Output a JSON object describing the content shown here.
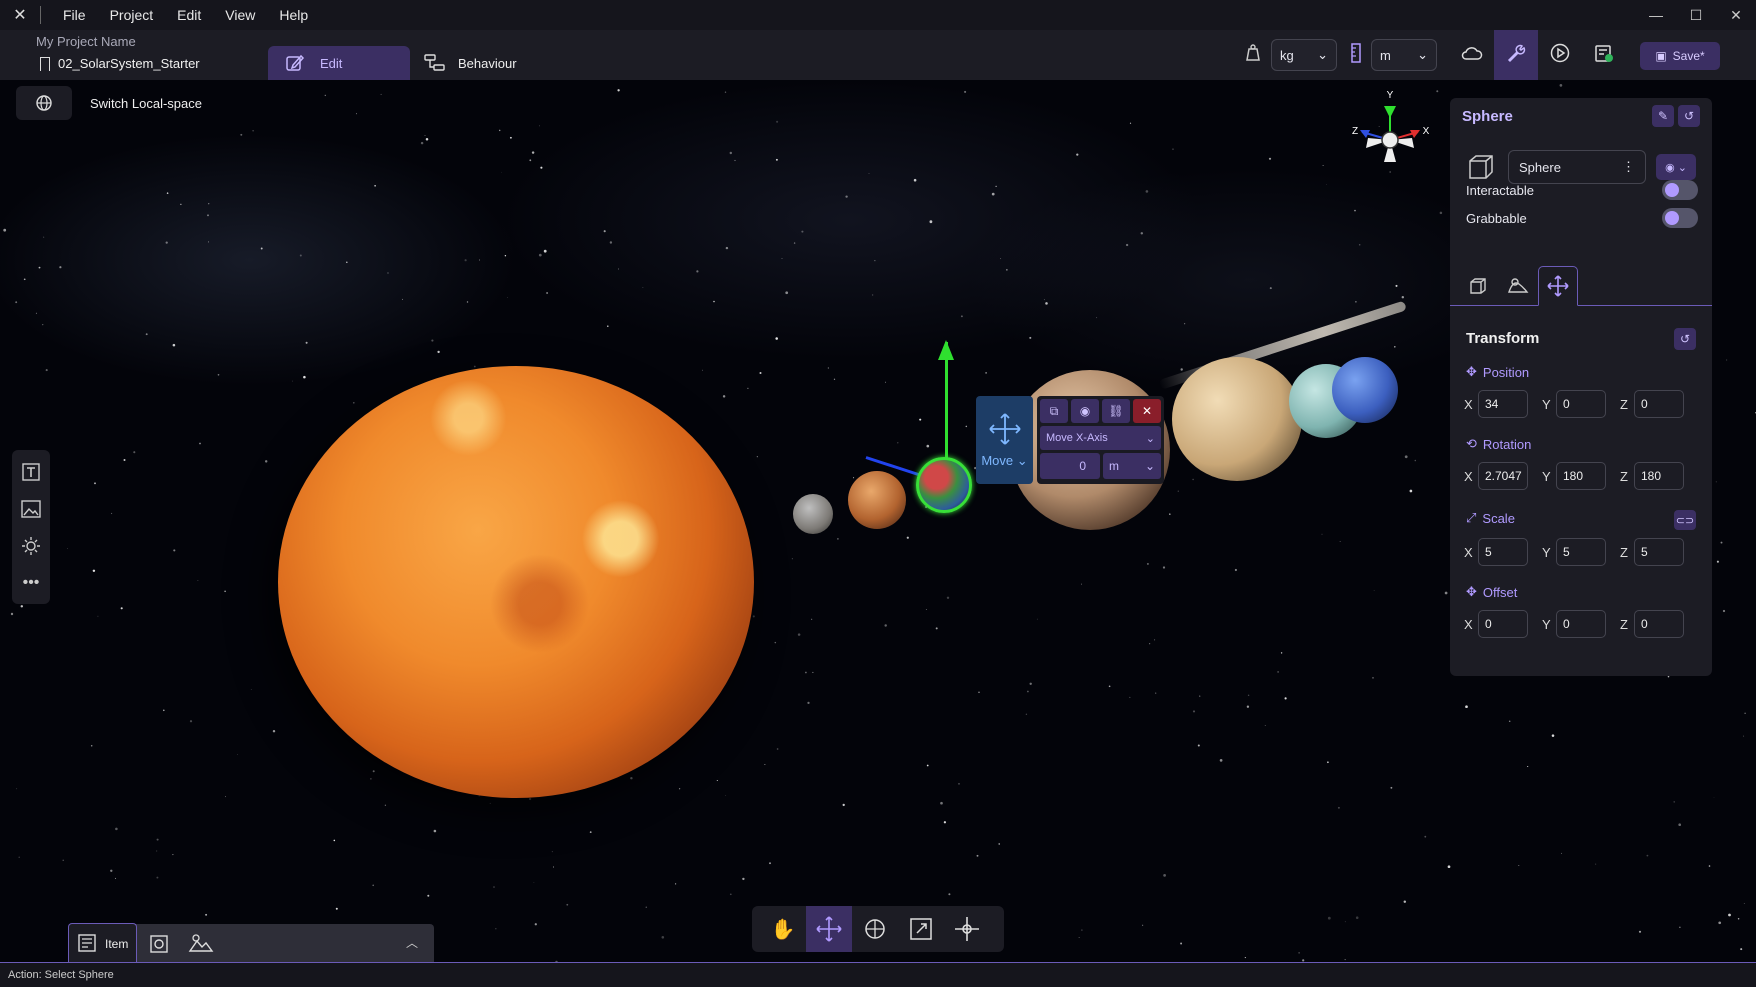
{
  "menubar": {
    "items": [
      "File",
      "Project",
      "Edit",
      "View",
      "Help"
    ]
  },
  "toolbar": {
    "project_name": "My Project Name",
    "scene_name": "02_SolarSystem_Starter",
    "tabs": [
      {
        "label": "Edit",
        "active": true
      },
      {
        "label": "Behaviour",
        "active": false
      }
    ],
    "mass_unit": "kg",
    "length_unit": "m",
    "save_label": "Save*"
  },
  "viewport": {
    "switch_local_label": "Switch Local-space",
    "axis_labels": {
      "x": "X",
      "y": "Y",
      "z": "Z"
    },
    "move_popup": {
      "mode_label": "Move",
      "axis_select": "Move X-Axis",
      "value": "0",
      "unit": "m"
    }
  },
  "panel": {
    "title": "Sphere",
    "object_name": "Sphere",
    "interactable_label": "Interactable",
    "grabbable_label": "Grabbable",
    "interactable": false,
    "grabbable": false,
    "section_title": "Transform",
    "position": {
      "label": "Position",
      "x": "34",
      "y": "0",
      "z": "0"
    },
    "rotation": {
      "label": "Rotation",
      "x": "2.7047",
      "y": "180",
      "z": "180"
    },
    "scale": {
      "label": "Scale",
      "x": "5",
      "y": "5",
      "z": "5"
    },
    "offset": {
      "label": "Offset",
      "x": "0",
      "y": "0",
      "z": "0"
    }
  },
  "bottom": {
    "item_tab_label": "Item"
  },
  "status": {
    "text": "Action: Select Sphere"
  },
  "colors": {
    "accent": "#3b2f63",
    "accent_text": "#c7b9ff",
    "panel_bg": "#1c1c24"
  }
}
